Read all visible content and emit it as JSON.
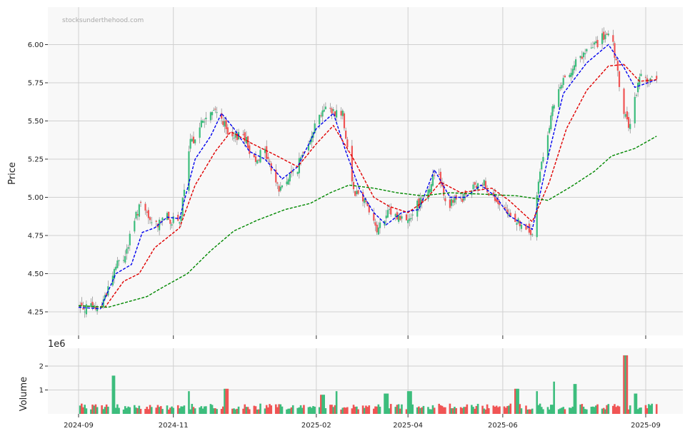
{
  "watermark": "stocksunderthehood.com",
  "colors": {
    "up": "#3dbd7d",
    "down": "#f05454",
    "ma_short": "#0000ee",
    "ma_mid": "#e00000",
    "ma_long": "#008800",
    "panel_bg": "#f8f8f8",
    "grid": "#d0d0d0"
  },
  "chart_data": [
    {
      "type": "candlestick",
      "ylabel": "Price",
      "ylim": [
        4.1,
        6.24
      ],
      "yticks": [
        "4.25",
        "4.50",
        "4.75",
        "5.00",
        "5.25",
        "5.50",
        "5.75",
        "6.00"
      ],
      "xticks": [
        "2024-09",
        "2024-11",
        "2025-02",
        "2025-04",
        "2025-06",
        "2025-09"
      ],
      "close_anchors": [
        {
          "date": "2024-09-01",
          "close": 4.29
        },
        {
          "date": "2024-09-15",
          "close": 4.27
        },
        {
          "date": "2024-09-25",
          "close": 4.55
        },
        {
          "date": "2024-10-01",
          "close": 4.62
        },
        {
          "date": "2024-10-10",
          "close": 4.95
        },
        {
          "date": "2024-10-20",
          "close": 4.8
        },
        {
          "date": "2024-10-25",
          "close": 4.88
        },
        {
          "date": "2024-11-05",
          "close": 4.82
        },
        {
          "date": "2024-11-12",
          "close": 5.35
        },
        {
          "date": "2024-11-20",
          "close": 5.5
        },
        {
          "date": "2024-11-30",
          "close": 5.58
        },
        {
          "date": "2024-12-08",
          "close": 5.35
        },
        {
          "date": "2024-12-15",
          "close": 5.45
        },
        {
          "date": "2024-12-22",
          "close": 5.25
        },
        {
          "date": "2024-12-30",
          "close": 5.3
        },
        {
          "date": "2025-01-08",
          "close": 5.05
        },
        {
          "date": "2025-01-20",
          "close": 5.2
        },
        {
          "date": "2025-01-30",
          "close": 5.45
        },
        {
          "date": "2025-02-05",
          "close": 5.58
        },
        {
          "date": "2025-02-18",
          "close": 5.55
        },
        {
          "date": "2025-02-25",
          "close": 5.05
        },
        {
          "date": "2025-03-05",
          "close": 4.98
        },
        {
          "date": "2025-03-12",
          "close": 4.78
        },
        {
          "date": "2025-03-20",
          "close": 4.9
        },
        {
          "date": "2025-03-31",
          "close": 4.85
        },
        {
          "date": "2025-04-07",
          "close": 4.95
        },
        {
          "date": "2025-04-14",
          "close": 5.05
        },
        {
          "date": "2025-04-20",
          "close": 5.2
        },
        {
          "date": "2025-04-26",
          "close": 4.95
        },
        {
          "date": "2025-05-05",
          "close": 4.98
        },
        {
          "date": "2025-05-12",
          "close": 5.05
        },
        {
          "date": "2025-05-20",
          "close": 5.1
        },
        {
          "date": "2025-05-30",
          "close": 4.92
        },
        {
          "date": "2025-06-10",
          "close": 4.85
        },
        {
          "date": "2025-06-20",
          "close": 4.75
        },
        {
          "date": "2025-06-26",
          "close": 5.25
        },
        {
          "date": "2025-07-05",
          "close": 5.65
        },
        {
          "date": "2025-07-15",
          "close": 5.85
        },
        {
          "date": "2025-07-25",
          "close": 5.95
        },
        {
          "date": "2025-08-05",
          "close": 6.05
        },
        {
          "date": "2025-08-10",
          "close": 6.05
        },
        {
          "date": "2025-08-18",
          "close": 5.55
        },
        {
          "date": "2025-08-22",
          "close": 5.45
        },
        {
          "date": "2025-08-28",
          "close": 5.8
        },
        {
          "date": "2025-09-08",
          "close": 5.76
        }
      ],
      "series": [
        {
          "kind": "moving_average",
          "points": [
            {
              "date": "2024-09-01",
              "y": 4.28
            },
            {
              "date": "2024-09-15",
              "y": 4.27
            },
            {
              "date": "2024-09-25",
              "y": 4.5
            },
            {
              "date": "2024-10-05",
              "y": 4.56
            },
            {
              "date": "2024-10-12",
              "y": 4.77
            },
            {
              "date": "2024-10-20",
              "y": 4.8
            },
            {
              "date": "2024-10-28",
              "y": 4.87
            },
            {
              "date": "2024-11-05",
              "y": 4.86
            },
            {
              "date": "2024-11-15",
              "y": 5.25
            },
            {
              "date": "2024-11-25",
              "y": 5.4
            },
            {
              "date": "2024-12-02",
              "y": 5.55
            },
            {
              "date": "2024-12-10",
              "y": 5.45
            },
            {
              "date": "2024-12-20",
              "y": 5.3
            },
            {
              "date": "2024-12-30",
              "y": 5.25
            },
            {
              "date": "2025-01-10",
              "y": 5.12
            },
            {
              "date": "2025-01-20",
              "y": 5.2
            },
            {
              "date": "2025-02-01",
              "y": 5.45
            },
            {
              "date": "2025-02-12",
              "y": 5.55
            },
            {
              "date": "2025-02-20",
              "y": 5.3
            },
            {
              "date": "2025-03-01",
              "y": 5.05
            },
            {
              "date": "2025-03-10",
              "y": 4.9
            },
            {
              "date": "2025-03-18",
              "y": 4.82
            },
            {
              "date": "2025-03-28",
              "y": 4.9
            },
            {
              "date": "2025-04-08",
              "y": 4.92
            },
            {
              "date": "2025-04-18",
              "y": 5.18
            },
            {
              "date": "2025-04-28",
              "y": 5.0
            },
            {
              "date": "2025-05-08",
              "y": 5.0
            },
            {
              "date": "2025-05-18",
              "y": 5.08
            },
            {
              "date": "2025-05-28",
              "y": 5.0
            },
            {
              "date": "2025-06-05",
              "y": 4.88
            },
            {
              "date": "2025-06-20",
              "y": 4.79
            },
            {
              "date": "2025-07-01",
              "y": 5.3
            },
            {
              "date": "2025-07-10",
              "y": 5.68
            },
            {
              "date": "2025-07-25",
              "y": 5.88
            },
            {
              "date": "2025-08-08",
              "y": 6.0
            },
            {
              "date": "2025-08-18",
              "y": 5.85
            },
            {
              "date": "2025-08-25",
              "y": 5.72
            },
            {
              "date": "2025-09-08",
              "y": 5.77
            }
          ]
        },
        {
          "kind": "moving_average",
          "points": [
            {
              "date": "2024-09-01",
              "y": 4.29
            },
            {
              "date": "2024-09-18",
              "y": 4.28
            },
            {
              "date": "2024-09-30",
              "y": 4.45
            },
            {
              "date": "2024-10-10",
              "y": 4.5
            },
            {
              "date": "2024-10-20",
              "y": 4.67
            },
            {
              "date": "2024-11-05",
              "y": 4.8
            },
            {
              "date": "2024-11-15",
              "y": 5.08
            },
            {
              "date": "2024-11-28",
              "y": 5.3
            },
            {
              "date": "2024-12-08",
              "y": 5.43
            },
            {
              "date": "2024-12-22",
              "y": 5.35
            },
            {
              "date": "2025-01-05",
              "y": 5.28
            },
            {
              "date": "2025-01-20",
              "y": 5.2
            },
            {
              "date": "2025-02-01",
              "y": 5.35
            },
            {
              "date": "2025-02-12",
              "y": 5.47
            },
            {
              "date": "2025-02-25",
              "y": 5.25
            },
            {
              "date": "2025-03-10",
              "y": 5.0
            },
            {
              "date": "2025-03-20",
              "y": 4.94
            },
            {
              "date": "2025-04-01",
              "y": 4.9
            },
            {
              "date": "2025-04-12",
              "y": 4.98
            },
            {
              "date": "2025-04-22",
              "y": 5.1
            },
            {
              "date": "2025-05-05",
              "y": 5.03
            },
            {
              "date": "2025-05-25",
              "y": 5.06
            },
            {
              "date": "2025-06-05",
              "y": 4.98
            },
            {
              "date": "2025-06-20",
              "y": 4.84
            },
            {
              "date": "2025-07-01",
              "y": 5.1
            },
            {
              "date": "2025-07-12",
              "y": 5.45
            },
            {
              "date": "2025-07-25",
              "y": 5.7
            },
            {
              "date": "2025-08-08",
              "y": 5.86
            },
            {
              "date": "2025-08-18",
              "y": 5.87
            },
            {
              "date": "2025-08-28",
              "y": 5.76
            },
            {
              "date": "2025-09-08",
              "y": 5.77
            }
          ]
        },
        {
          "kind": "moving_average",
          "points": [
            {
              "date": "2024-09-01",
              "y": 4.29
            },
            {
              "date": "2024-09-20",
              "y": 4.28
            },
            {
              "date": "2024-10-15",
              "y": 4.35
            },
            {
              "date": "2024-10-25",
              "y": 4.41
            },
            {
              "date": "2024-11-10",
              "y": 4.5
            },
            {
              "date": "2024-11-25",
              "y": 4.65
            },
            {
              "date": "2024-12-10",
              "y": 4.78
            },
            {
              "date": "2024-12-25",
              "y": 4.85
            },
            {
              "date": "2025-01-12",
              "y": 4.92
            },
            {
              "date": "2025-01-28",
              "y": 4.96
            },
            {
              "date": "2025-02-10",
              "y": 5.03
            },
            {
              "date": "2025-02-22",
              "y": 5.08
            },
            {
              "date": "2025-03-10",
              "y": 5.06
            },
            {
              "date": "2025-03-25",
              "y": 5.03
            },
            {
              "date": "2025-04-10",
              "y": 5.01
            },
            {
              "date": "2025-04-28",
              "y": 5.03
            },
            {
              "date": "2025-05-20",
              "y": 5.02
            },
            {
              "date": "2025-06-10",
              "y": 5.01
            },
            {
              "date": "2025-06-30",
              "y": 4.98
            },
            {
              "date": "2025-07-15",
              "y": 5.07
            },
            {
              "date": "2025-07-30",
              "y": 5.17
            },
            {
              "date": "2025-08-10",
              "y": 5.27
            },
            {
              "date": "2025-08-25",
              "y": 5.32
            },
            {
              "date": "2025-09-08",
              "y": 5.4
            }
          ]
        }
      ]
    },
    {
      "type": "bar",
      "ylabel": "Volume",
      "ylabel_exponent": "1e6",
      "yticks": [
        "1",
        "2"
      ],
      "ylim": [
        0,
        2.75
      ],
      "spikes": [
        {
          "date": "2024-09-23",
          "volume": 1.6
        },
        {
          "date": "2024-11-10",
          "volume": 0.95
        },
        {
          "date": "2024-12-05",
          "volume": 1.05
        },
        {
          "date": "2025-02-05",
          "volume": 0.8
        },
        {
          "date": "2025-02-15",
          "volume": 0.95
        },
        {
          "date": "2025-03-18",
          "volume": 0.85
        },
        {
          "date": "2025-04-02",
          "volume": 0.95
        },
        {
          "date": "2025-06-10",
          "volume": 1.05
        },
        {
          "date": "2025-06-22",
          "volume": 0.95
        },
        {
          "date": "2025-07-05",
          "volume": 1.35
        },
        {
          "date": "2025-07-18",
          "volume": 1.25
        },
        {
          "date": "2025-08-19",
          "volume": 2.45
        },
        {
          "date": "2025-08-25",
          "volume": 0.85
        }
      ]
    }
  ]
}
